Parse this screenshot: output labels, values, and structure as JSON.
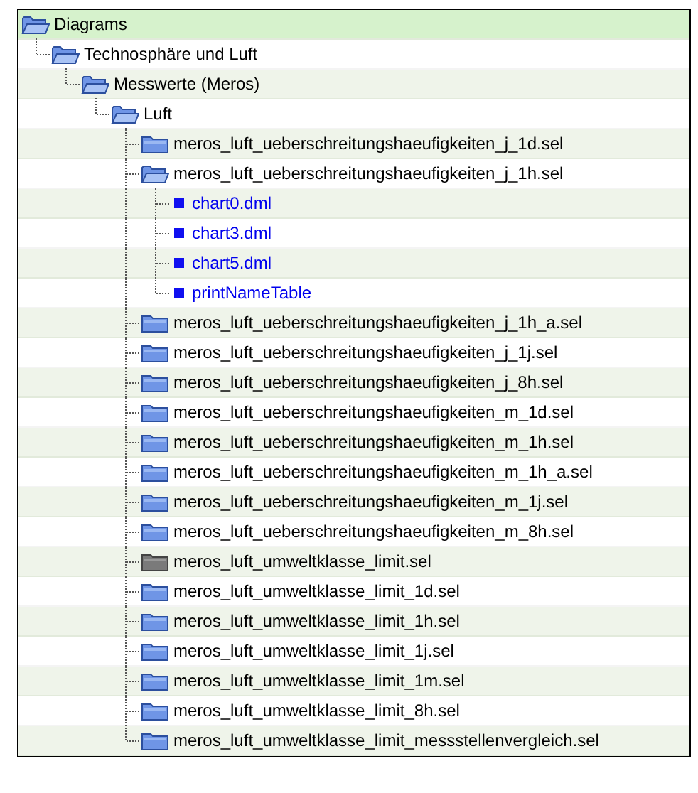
{
  "tree": [
    {
      "label": "Diagrams",
      "kind": "folder",
      "expanded": true,
      "selected": true,
      "children": [
        {
          "label": "Technosphäre und Luft",
          "kind": "folder",
          "expanded": true,
          "selected": false,
          "children": [
            {
              "label": "Messwerte (Meros)",
              "kind": "folder",
              "expanded": true,
              "selected": false,
              "children": [
                {
                  "label": "Luft",
                  "kind": "folder",
                  "expanded": true,
                  "selected": false,
                  "children": [
                    {
                      "label": "meros_luft_ueberschreitungshaeufigkeiten_j_1d.sel",
                      "kind": "folder",
                      "expanded": false,
                      "selected": false
                    },
                    {
                      "label": "meros_luft_ueberschreitungshaeufigkeiten_j_1h.sel",
                      "kind": "folder",
                      "expanded": true,
                      "selected": false,
                      "children": [
                        {
                          "label": "chart0.dml",
                          "kind": "file",
                          "selected": false
                        },
                        {
                          "label": "chart3.dml",
                          "kind": "file",
                          "selected": false
                        },
                        {
                          "label": "chart5.dml",
                          "kind": "file",
                          "selected": false
                        },
                        {
                          "label": "printNameTable",
                          "kind": "file",
                          "selected": false
                        }
                      ]
                    },
                    {
                      "label": "meros_luft_ueberschreitungshaeufigkeiten_j_1h_a.sel",
                      "kind": "folder",
                      "expanded": false,
                      "selected": false
                    },
                    {
                      "label": "meros_luft_ueberschreitungshaeufigkeiten_j_1j.sel",
                      "kind": "folder",
                      "expanded": false,
                      "selected": false
                    },
                    {
                      "label": "meros_luft_ueberschreitungshaeufigkeiten_j_8h.sel",
                      "kind": "folder",
                      "expanded": false,
                      "selected": false
                    },
                    {
                      "label": "meros_luft_ueberschreitungshaeufigkeiten_m_1d.sel",
                      "kind": "folder",
                      "expanded": false,
                      "selected": false
                    },
                    {
                      "label": "meros_luft_ueberschreitungshaeufigkeiten_m_1h.sel",
                      "kind": "folder",
                      "expanded": false,
                      "selected": false
                    },
                    {
                      "label": "meros_luft_ueberschreitungshaeufigkeiten_m_1h_a.sel",
                      "kind": "folder",
                      "expanded": false,
                      "selected": false
                    },
                    {
                      "label": "meros_luft_ueberschreitungshaeufigkeiten_m_1j.sel",
                      "kind": "folder",
                      "expanded": false,
                      "selected": false
                    },
                    {
                      "label": "meros_luft_ueberschreitungshaeufigkeiten_m_8h.sel",
                      "kind": "folder",
                      "expanded": false,
                      "selected": false
                    },
                    {
                      "label": "meros_luft_umweltklasse_limit.sel",
                      "kind": "gray-folder",
                      "expanded": false,
                      "selected": false
                    },
                    {
                      "label": "meros_luft_umweltklasse_limit_1d.sel",
                      "kind": "folder",
                      "expanded": false,
                      "selected": false
                    },
                    {
                      "label": "meros_luft_umweltklasse_limit_1h.sel",
                      "kind": "folder",
                      "expanded": false,
                      "selected": false
                    },
                    {
                      "label": "meros_luft_umweltklasse_limit_1j.sel",
                      "kind": "folder",
                      "expanded": false,
                      "selected": false
                    },
                    {
                      "label": "meros_luft_umweltklasse_limit_1m.sel",
                      "kind": "folder",
                      "expanded": false,
                      "selected": false
                    },
                    {
                      "label": "meros_luft_umweltklasse_limit_8h.sel",
                      "kind": "folder",
                      "expanded": false,
                      "selected": false
                    },
                    {
                      "label": "meros_luft_umweltklasse_limit_messstellenvergleich.sel",
                      "kind": "folder",
                      "expanded": false,
                      "selected": false
                    }
                  ]
                }
              ]
            }
          ]
        }
      ]
    }
  ]
}
